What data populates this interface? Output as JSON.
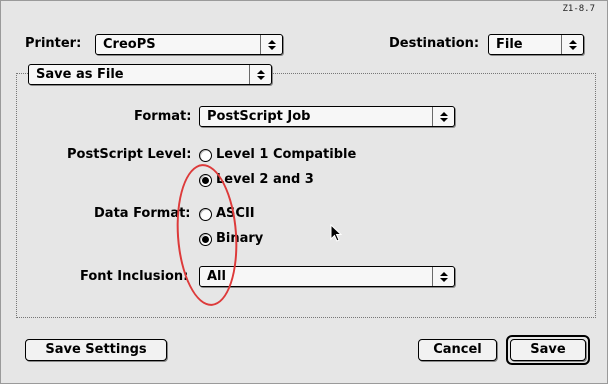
{
  "header": {
    "version": "Z1-8.7",
    "printer_label": "Printer:",
    "printer_value": "CreoPS",
    "destination_label": "Destination:",
    "destination_value": "File"
  },
  "panel_popup": {
    "value": "Save as File"
  },
  "format": {
    "label": "Format:",
    "value": "PostScript Job"
  },
  "postscript_level": {
    "label": "PostScript Level:",
    "options": [
      {
        "label": "Level 1 Compatible",
        "selected": false
      },
      {
        "label": "Level 2 and 3",
        "selected": true
      }
    ]
  },
  "data_format": {
    "label": "Data Format:",
    "options": [
      {
        "label": "ASCII",
        "selected": false
      },
      {
        "label": "Binary",
        "selected": true
      }
    ]
  },
  "font_inclusion": {
    "label": "Font Inclusion:",
    "value": "All"
  },
  "buttons": {
    "save_settings": "Save Settings",
    "cancel": "Cancel",
    "save": "Save"
  },
  "colors": {
    "annotation": "#dd3a3a",
    "dialog_bg": "#e6e6e6"
  },
  "icons": {
    "popup_arrows": "up-down-arrows-icon",
    "cursor": "arrow-cursor-icon"
  }
}
